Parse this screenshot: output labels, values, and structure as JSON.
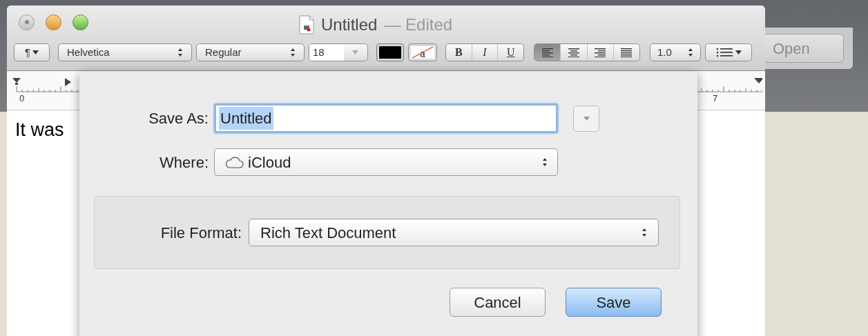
{
  "window": {
    "title": "Untitled",
    "status": "— Edited"
  },
  "toolbar": {
    "paragraph_menu": "¶",
    "font_family": "Helvetica",
    "font_style": "Regular",
    "font_size": "18",
    "highlight_sample": "a",
    "styles": [
      {
        "kind": "bold",
        "label": "B"
      },
      {
        "kind": "italic",
        "label": "I"
      },
      {
        "kind": "underline",
        "label": "U"
      }
    ],
    "alignments": [
      {
        "kind": "left",
        "selected": true
      },
      {
        "kind": "center",
        "selected": false
      },
      {
        "kind": "right",
        "selected": false
      },
      {
        "kind": "justify",
        "selected": false
      }
    ],
    "line_spacing": "1.0"
  },
  "ruler": {
    "marks": [
      "0",
      "7"
    ]
  },
  "document": {
    "text": "It was"
  },
  "background_window": {
    "button": "Open"
  },
  "save_sheet": {
    "save_as_label": "Save As:",
    "filename": "Untitled",
    "where_label": "Where:",
    "where_value": "iCloud",
    "file_format_label": "File Format:",
    "file_format_value": "Rich Text Document",
    "buttons": [
      {
        "label": "Cancel",
        "default": false
      },
      {
        "label": "Save",
        "default": true
      }
    ]
  }
}
